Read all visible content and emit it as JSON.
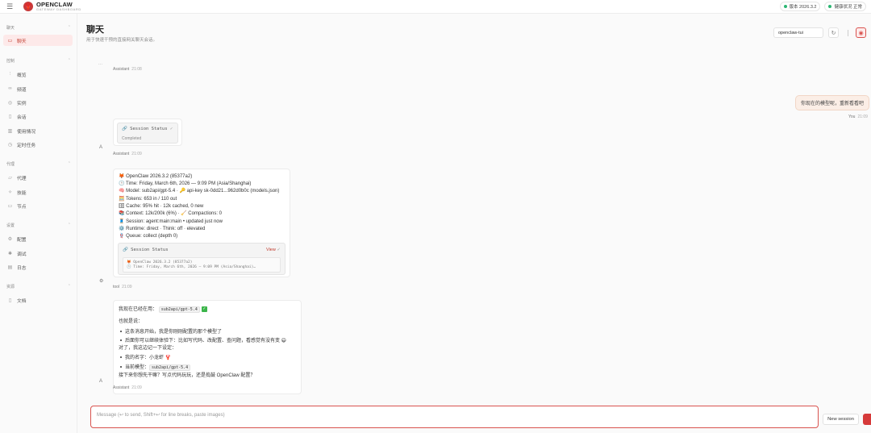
{
  "header": {
    "brand_name": "OPENCLAW",
    "brand_sub": "GATEWAY DASHBOARD",
    "version_label": "版本 2026.3.2",
    "health_label": "健康状况 正常"
  },
  "sidebar": {
    "sections": [
      {
        "title": "聊天",
        "items": [
          {
            "label": "聊天",
            "icon": "chat-icon",
            "active": true
          }
        ]
      },
      {
        "title": "控制",
        "items": [
          {
            "label": "概览",
            "icon": "chart-icon"
          },
          {
            "label": "频道",
            "icon": "link-icon"
          },
          {
            "label": "实例",
            "icon": "radio-icon"
          },
          {
            "label": "会话",
            "icon": "document-icon"
          },
          {
            "label": "使用情况",
            "icon": "bar-icon"
          },
          {
            "label": "定时任务",
            "icon": "clock-icon"
          }
        ]
      },
      {
        "title": "代理",
        "items": [
          {
            "label": "代理",
            "icon": "folder-icon"
          },
          {
            "label": "技能",
            "icon": "bolt-icon"
          },
          {
            "label": "节点",
            "icon": "monitor-icon"
          }
        ]
      },
      {
        "title": "设置",
        "items": [
          {
            "label": "配置",
            "icon": "gear-icon"
          },
          {
            "label": "调试",
            "icon": "bug-icon"
          },
          {
            "label": "日志",
            "icon": "log-icon"
          }
        ]
      },
      {
        "title": "资源",
        "items": [
          {
            "label": "文档",
            "icon": "book-icon"
          }
        ]
      }
    ]
  },
  "main": {
    "title": "聊天",
    "subtitle": "用于快速干预的直接网关聊天会话。",
    "session_value": "openclaw-tui"
  },
  "chat": {
    "msg1": {
      "ellipsis": "···",
      "role": "Assistant",
      "time": "21:08"
    },
    "user": {
      "text": "你现在的模型呢，重新看看吧",
      "role": "You",
      "time": "21:09"
    },
    "msg2": {
      "avatar": "A",
      "card_title": "Session Status",
      "card_status": "Completed",
      "role": "Assistant",
      "time": "21:09"
    },
    "msg3": {
      "avatar": "⚙",
      "lines": [
        "🦊 OpenClaw 2026.3.2 (85377a2)",
        "🕒 Time: Friday, March 6th, 2026 — 9:09 PM (Asia/Shanghai)",
        "🧠 Model: sub2api/gpt-5.4 · 🔑 api-key sk-0dd21...962d0b0c (models.json)",
        "🧮 Tokens: 653 in / 110 out",
        "🗄 Cache: 95% hit · 12k cached, 0 new",
        "📚 Context: 12k/200k (6%) · 🧹 Compactions: 0",
        "🧵 Session: agent:main:main • updated just now",
        "⚙️ Runtime: direct · Think: off · elevated",
        "🪢 Queue: collect (depth 0)"
      ],
      "card_title": "Session Status",
      "card_view": "View",
      "preview_lines": [
        "🦊 OpenClaw 2026.3.2 (85377a2)",
        "🕒 Time: Friday, March 6th, 2026 — 9:09 PM (Asia/Shanghai)…"
      ],
      "role": "tool",
      "time": "21:09"
    },
    "msg4": {
      "avatar": "A",
      "line1_prefix": "我现在已经在用：",
      "line1_code": "sub2api/gpt-5.4",
      "line2": "也就是说：",
      "bullet1": "这条消息开始，我是你刚刚配置的那个模型了",
      "bullet2": "后面你可以继续体验下：比如写代码、改配置、查问题，看感觉有没有变 😄",
      "line3": "对了，我这边记一下设定：",
      "bullet3": "我的名字：小龙虾 🦞",
      "bullet4_prefix": "当前模型：",
      "bullet4_code": "sub2api/gpt-5.4",
      "line4": "接下来你想先干嘛？写点代码玩玩，还是捣鼓 OpenClaw 配置？",
      "role": "Assistant",
      "time": "21:09"
    }
  },
  "composer": {
    "placeholder": "Message (↩ to send, Shift+↩ for line breaks, paste images)",
    "new_session": "New session"
  }
}
